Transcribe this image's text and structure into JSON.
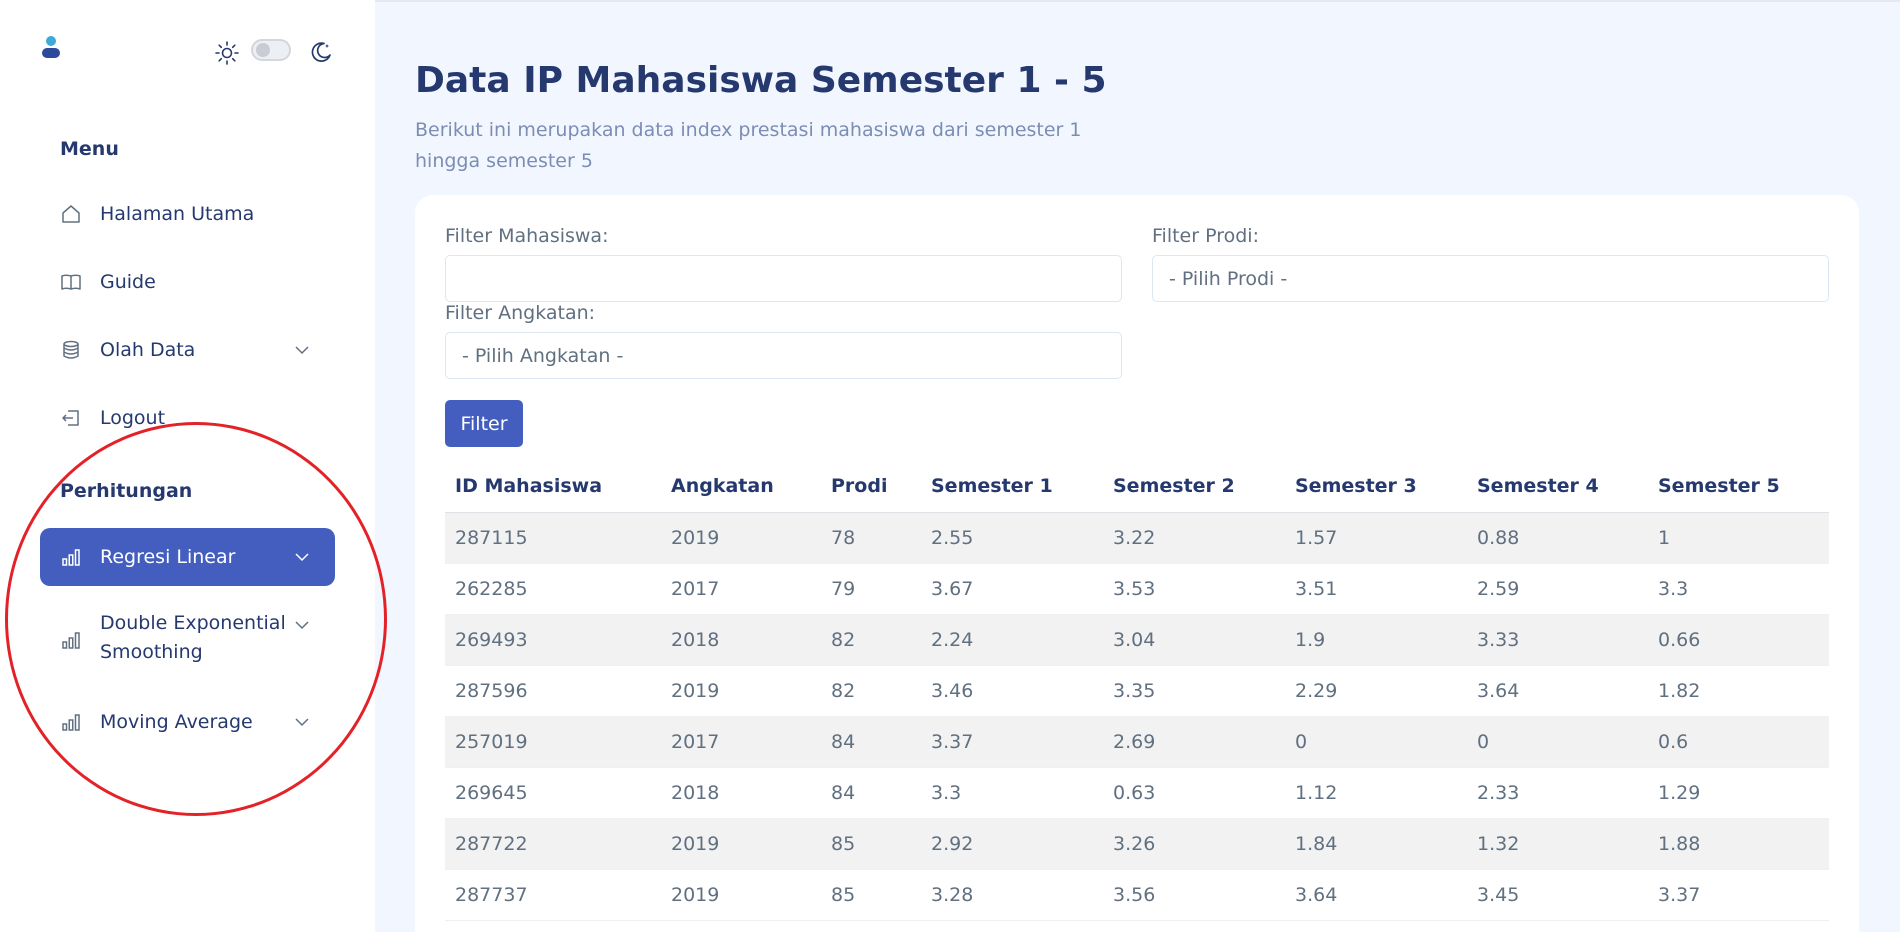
{
  "sidebar": {
    "menu_title": "Menu",
    "items": [
      {
        "label": "Halaman Utama",
        "icon": "home-icon"
      },
      {
        "label": "Guide",
        "icon": "book-icon"
      },
      {
        "label": "Olah Data",
        "icon": "database-icon",
        "has_submenu": true
      },
      {
        "label": "Logout",
        "icon": "logout-icon"
      }
    ],
    "section_title": "Perhitungan",
    "calc_items": [
      {
        "label": "Regresi Linear",
        "icon": "bar-chart-icon",
        "active": true
      },
      {
        "label": "Double Exponential Smoothing",
        "label_line1": "Double Exponential",
        "label_line2": "Smoothing",
        "icon": "bar-chart-icon"
      },
      {
        "label": "Moving Average",
        "icon": "bar-chart-icon"
      }
    ]
  },
  "main": {
    "title": "Data IP Mahasiswa Semester 1 - 5",
    "subtitle": "Berikut ini merupakan data index prestasi mahasiswa dari semester 1 hingga semester 5",
    "filters": {
      "mahasiswa_label": "Filter Mahasiswa:",
      "mahasiswa_value": "",
      "prodi_label": "Filter Prodi:",
      "prodi_value": "- Pilih Prodi -",
      "angkatan_label": "Filter Angkatan:",
      "angkatan_value": "- Pilih Angkatan -",
      "button": "Filter"
    },
    "table": {
      "headers": [
        "ID Mahasiswa",
        "Angkatan",
        "Prodi",
        "Semester 1",
        "Semester 2",
        "Semester 3",
        "Semester 4",
        "Semester 5"
      ],
      "rows": [
        [
          "287115",
          "2019",
          "78",
          "2.55",
          "3.22",
          "1.57",
          "0.88",
          "1"
        ],
        [
          "262285",
          "2017",
          "79",
          "3.67",
          "3.53",
          "3.51",
          "2.59",
          "3.3"
        ],
        [
          "269493",
          "2018",
          "82",
          "2.24",
          "3.04",
          "1.9",
          "3.33",
          "0.66"
        ],
        [
          "287596",
          "2019",
          "82",
          "3.46",
          "3.35",
          "2.29",
          "3.64",
          "1.82"
        ],
        [
          "257019",
          "2017",
          "84",
          "3.37",
          "2.69",
          "0",
          "0",
          "0.6"
        ],
        [
          "269645",
          "2018",
          "84",
          "3.3",
          "0.63",
          "1.12",
          "2.33",
          "1.29"
        ],
        [
          "287722",
          "2019",
          "85",
          "2.92",
          "3.26",
          "1.84",
          "1.32",
          "1.88"
        ],
        [
          "287737",
          "2019",
          "85",
          "3.28",
          "3.56",
          "3.64",
          "3.45",
          "3.37"
        ]
      ]
    }
  },
  "colors": {
    "primary": "#435ebe",
    "text_dark": "#25396f",
    "text_muted": "#7c8db5",
    "background": "#f2f7ff",
    "annotation": "#e32228"
  }
}
